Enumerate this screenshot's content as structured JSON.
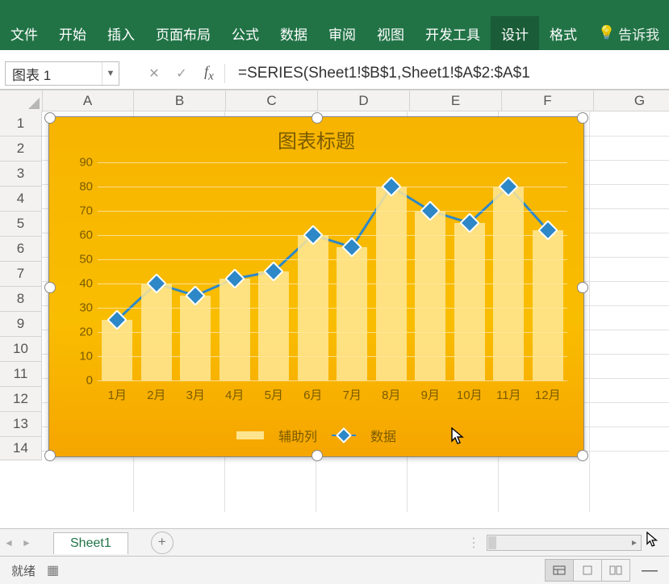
{
  "ribbon": {
    "tabs": [
      "文件",
      "开始",
      "插入",
      "页面布局",
      "公式",
      "数据",
      "审阅",
      "视图",
      "开发工具",
      "设计",
      "格式"
    ],
    "tell_me": "告诉我"
  },
  "namebox": "图表 1",
  "formula": "=SERIES(Sheet1!$B$1,Sheet1!$A$2:$A$1",
  "columns": [
    "A",
    "B",
    "C",
    "D",
    "E",
    "F",
    "G"
  ],
  "rows": [
    "1",
    "2",
    "3",
    "4",
    "5",
    "6",
    "7",
    "8",
    "9",
    "10",
    "11",
    "12",
    "13",
    "14"
  ],
  "sheet_tab": "Sheet1",
  "status_text": "就绪",
  "chart_data": {
    "type": "line",
    "title": "图表标题",
    "categories": [
      "1月",
      "2月",
      "3月",
      "4月",
      "5月",
      "6月",
      "7月",
      "8月",
      "9月",
      "10月",
      "11月",
      "12月"
    ],
    "series": [
      {
        "name": "辅助列",
        "values": [
          25,
          40,
          35,
          42,
          45,
          60,
          55,
          80,
          70,
          65,
          80,
          62
        ]
      },
      {
        "name": "数据",
        "values": [
          25,
          40,
          35,
          42,
          45,
          60,
          55,
          80,
          70,
          65,
          80,
          62
        ]
      }
    ],
    "ylabel": "",
    "xlabel": "",
    "ylim": [
      0,
      90
    ],
    "yticks": [
      0,
      10,
      20,
      30,
      40,
      50,
      60,
      70,
      80,
      90
    ],
    "legend": [
      "辅助列",
      "数据"
    ]
  }
}
